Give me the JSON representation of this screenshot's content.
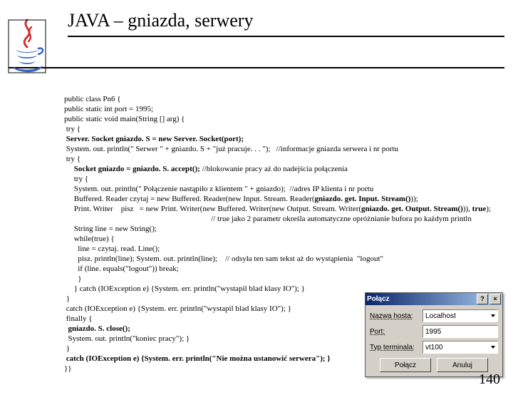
{
  "header": {
    "title": "JAVA – gniazda, serwery"
  },
  "page_number": "140",
  "code": {
    "l1": "public class Pn6 {",
    "l2": "public static int port = 1995;",
    "l3": "public static void main(String [] arg) {",
    "l4": " try {",
    "l5a": " Server. Socket gniazdo. S = new Server. Socket(port);",
    "l6": " System. out. println(\" Serwer \" + gniazdo. S + \"już pracuje. . . \");   //informacje gniazda serwera i nr portu",
    "l7": " try {",
    "l8a": "     Socket gniazdo = gniazdo. S. accept();",
    "l8b": " //blokowanie pracy aż do nadejścia połączenia",
    "l9": "     try {",
    "l10": "     System. out. println(\" Połączenie nastąpiło z klientem \" + gniazdo);  //adres IP klienta i nr portu",
    "l11a": "     Buffered. Reader czytaj = new Buffered. Reader(new Input. Stream. Reader(",
    "l11b": "gniazdo. get. Input. Stream()",
    "l11c": "));",
    "l12a": "     Print. Writer    pisz   = new Print. Writer(new Buffered. Writer(new Output. Stream. Writer(",
    "l12b": "gniazdo. get. Output. Stream()",
    "l12c": ")), ",
    "l12d": "true",
    "l12e": ");",
    "l13": "                                                                           // true jako 2 parametr określa automatyczne opróżnianie bufora po każdym println",
    "l14": "     String line = new String();",
    "l15": "     while(true) {",
    "l16": "       line = czytaj. read. Line();",
    "l17": "       pisz. println(line); System. out. println(line);    // odsyła ten sam tekst aż do wystąpienia  \"logout\"",
    "l18": "       if (line. equals(\"logout\")) break;",
    "l19": "       }",
    "l20": "     } catch (IOException e) {System. err. println(\"wystapil blad klasy IO\"); }",
    "l21": " }",
    "l22": " catch (IOException e) {System. err. println(\"wystapil blad klasy IO\"); }",
    "l23": " finally {",
    "l24a": "  gniazdo. S. close();",
    "l25": "  System. out. println(\"koniec pracy\"); }",
    "l26": " }",
    "l27a": " catch (IOException e) {System. err. println(\"Nie można ustanowić serwera\"); }",
    "l28": "}}"
  },
  "dialog": {
    "title": "Połącz",
    "host_label": "Nazwa hosta:",
    "host_value": "Localhost",
    "port_label": "Port:",
    "port_value": "1995",
    "term_label": "Typ terminala:",
    "term_value": "vt100",
    "connect": "Połącz",
    "cancel": "Anuluj"
  }
}
